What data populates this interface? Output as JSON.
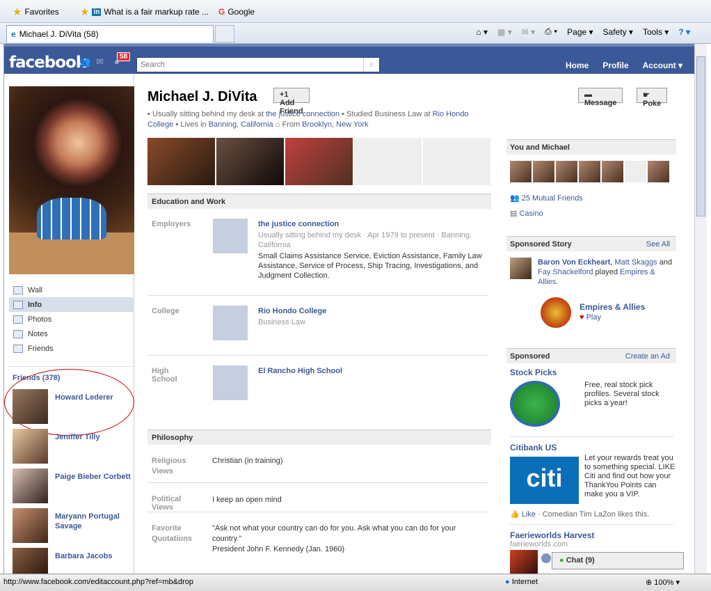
{
  "browser": {
    "favorites_label": "Favorites",
    "fav_link1": "What is a fair markup rate ...",
    "fav_link2": "Google",
    "tab_title": "Michael J. DiVita (58)",
    "cmd_page": "Page",
    "cmd_safety": "Safety",
    "cmd_tools": "Tools",
    "status_url": "http://www.facebook.com/editaccount.php?ref=mb&drop",
    "status_zone": "Internet",
    "zoom": "100%"
  },
  "header": {
    "logo": "facebook",
    "notif_count": "58",
    "search_placeholder": "Search",
    "nav_home": "Home",
    "nav_profile": "Profile",
    "nav_account": "Account"
  },
  "profile": {
    "name": "Michael J. DiVita",
    "add_friend": "Add Friend",
    "message": "Message",
    "poke": "Poke",
    "info1": "Usually sitting behind my desk at",
    "info1_link": "the justice connection",
    "info2": "Studied Business Law at",
    "info2_link": "Rio Hondo College",
    "info3": "Lives in",
    "info3_link": "Banning, California",
    "info4": "From",
    "info4_link": "Brooklyn, New York"
  },
  "leftnav": {
    "items": [
      "Wall",
      "Info",
      "Photos",
      "Notes",
      "Friends"
    ],
    "friends_heading": "Friends (378)",
    "friends": [
      "Howard Lederer",
      "Jeniffer Tilly",
      "Paige Bieber Corbett",
      "Maryann Portugal Savage",
      "Barbara Jacobs"
    ]
  },
  "education": {
    "heading": "Education and Work",
    "employers_label": "Employers",
    "employer_name": "the justice connection",
    "employer_detail": "Usually sitting behind my desk · Apr 1979 to present · Banning, California",
    "employer_desc": "Small Claims Assistance Service, Eviction Assistance, Family Law Assistance, Service of Process, Ship Tracing, Investigations, and Judgment Collection.",
    "college_label": "College",
    "college_name": "Rio Hondo College",
    "college_detail": "Business Law",
    "hs_label": "High School",
    "hs_name": "El Rancho High School"
  },
  "philosophy": {
    "heading": "Philosophy",
    "religious_label": "Religious Views",
    "religious_value": "Christian (in training)",
    "political_label": "Political Views",
    "political_value": "I keep an open mind",
    "quotes_label": "Favorite Quotations",
    "quotes_value": "\"Ask not what your country can do for you. Ask what you can do for your country.\"",
    "quotes_author": "President John F. Kennedy (Jan. 1960)"
  },
  "sidebar": {
    "you_and": "You and Michael",
    "mutual": "25 Mutual Friends",
    "casino": "Casino",
    "sponsored_story": "Sponsored Story",
    "see_all": "See All",
    "story_name1": "Baron Von Eckheart",
    "story_name2": "Matt Skaggs",
    "story_and": "and",
    "story_name3": "Fay Shackelford",
    "story_played": "played",
    "story_game": "Empires & Allies.",
    "game_title": "Empires & Allies",
    "game_play": "Play",
    "sponsored": "Sponsored",
    "create_ad": "Create an Ad",
    "ad1_title": "Stock Picks",
    "ad1_text": "Free, real stock pick profiles. Several stock picks a year!",
    "ad2_title": "Citibank US",
    "ad2_text": "Let your rewards treat you to something special. LIKE Citi and find out how your ThankYou Points can make you a VIP.",
    "ad2_like": "Like",
    "ad2_likes": "· Comedian Tim LaZon likes this.",
    "ad3_title": "Faerieworlds Harvest",
    "ad3_url": "faerieworlds.com",
    "chat": "Chat (9)"
  }
}
